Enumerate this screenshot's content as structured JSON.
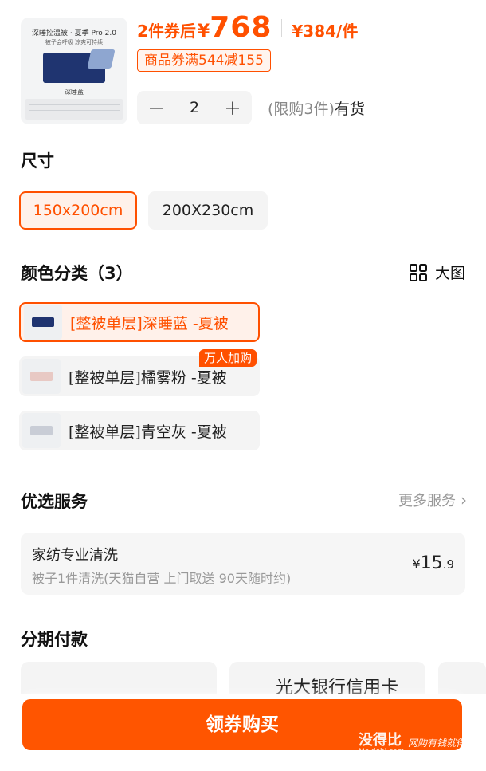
{
  "product_thumb": {
    "title": "深睡控温被 · 夏季 Pro 2.0",
    "subtitle": "被子会呼吸  凉爽可持续",
    "color_name": "深睡蓝"
  },
  "price": {
    "prefix": "2件券后",
    "currency": "¥",
    "amount": "768",
    "unit_price": "¥384/件"
  },
  "coupon": "商品券满544减155",
  "quantity": {
    "minus": "－",
    "value": "2",
    "plus": "＋"
  },
  "stock": {
    "limit": "(限购3件)",
    "status": "有货"
  },
  "size": {
    "title": "尺寸",
    "options": [
      "150x200cm",
      "200X230cm"
    ],
    "selected": "150x200cm"
  },
  "color": {
    "title": "颜色分类（3）",
    "big_view": "大图",
    "options": [
      {
        "label": "[整被单层]深睡蓝 -夏被",
        "swatch": "#1f3470"
      },
      {
        "label": "[整被单层]橘雾粉 -夏被",
        "swatch": "#e8c9c4"
      },
      {
        "label": "[整被单层]青空灰 -夏被",
        "swatch": "#c9cdd6"
      }
    ],
    "hot_tag": "万人加购"
  },
  "service": {
    "title": "优选服务",
    "more": "更多服务",
    "item_name": "家纺专业清洗",
    "item_desc": "被子1件清洗(天猫自营 上门取送 90天随时约)",
    "price_symbol": "¥",
    "price_int": "15",
    "price_dec": ".9"
  },
  "installment": {
    "title": "分期付款",
    "card2_text": "光大银行信用卡"
  },
  "buy_button": "领券购买",
  "watermark": {
    "logo": "没得比",
    "site": "Meidebi.com",
    "slogan": "网购有钱就得比"
  },
  "colors": {
    "accent": "#ff5000",
    "button": "#ff5500"
  }
}
